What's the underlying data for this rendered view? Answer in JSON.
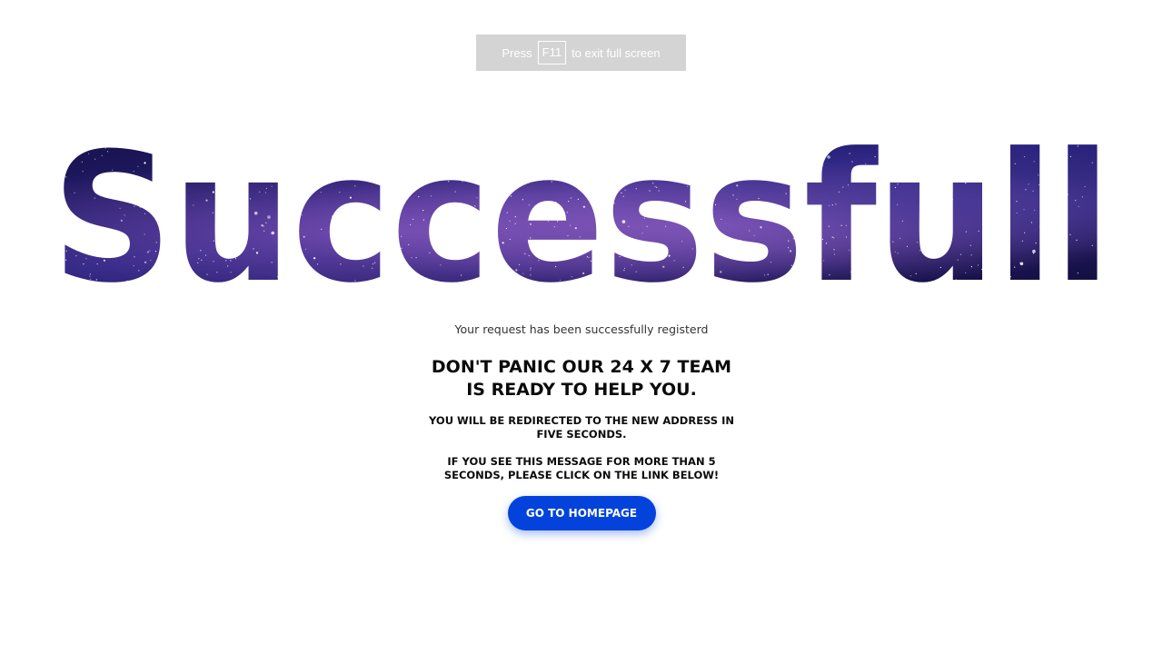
{
  "fullscreen_notice": {
    "prefix": "Press",
    "key": "F11",
    "suffix": "to exit full screen"
  },
  "hero": {
    "word": "Successfull",
    "fill_style": "starry galaxy texture",
    "colors": {
      "deep": "#0d0b3a",
      "mid": "#2a2378",
      "nebula": "#5a3e9e",
      "star": "#ffffff"
    }
  },
  "message": {
    "subline": "Your request has been successfully registerd",
    "headline": "DON'T PANIC OUR 24 X 7 TEAM IS READY TO HELP YOU.",
    "redirect_note": "YOU WILL BE REDIRECTED TO THE NEW ADDRESS IN FIVE SECONDS.",
    "fallback_note": "IF YOU SEE THIS MESSAGE FOR MORE THAN 5 SECONDS, PLEASE CLICK ON THE LINK BELOW!"
  },
  "cta": {
    "label": "GO TO HOMEPAGE",
    "color": "#0343dc"
  }
}
